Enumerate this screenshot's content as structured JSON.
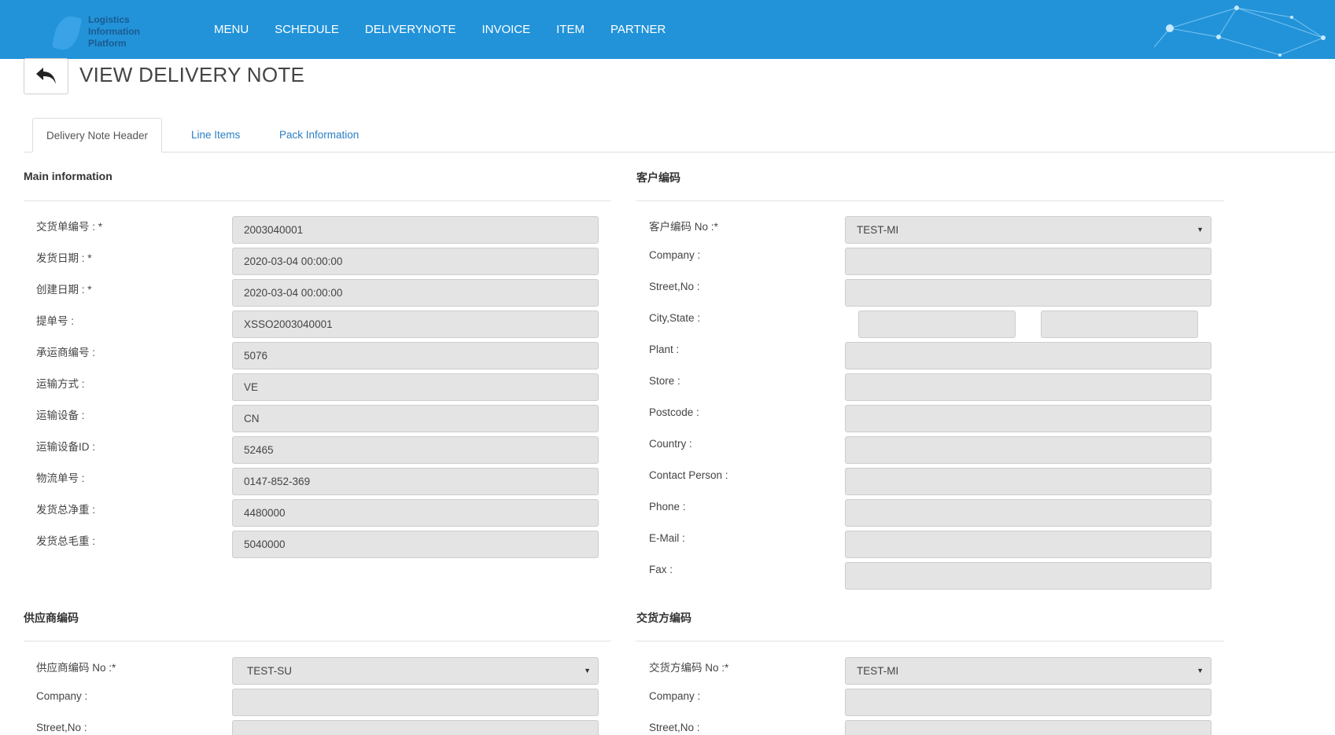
{
  "brand": {
    "logo_lines": [
      "Logistics",
      "Information",
      "Platform"
    ]
  },
  "nav": [
    "MENU",
    "SCHEDULE",
    "DELIVERYNOTE",
    "INVOICE",
    "ITEM",
    "PARTNER"
  ],
  "page": {
    "title": "VIEW DELIVERY NOTE"
  },
  "tabs": [
    "Delivery Note Header",
    "Line Items",
    "Pack Information"
  ],
  "main_info": {
    "title": "Main information",
    "fields": [
      {
        "label": "交货单编号 : *",
        "value": "2003040001"
      },
      {
        "label": "发货日期 : *",
        "value": "2020-03-04 00:00:00"
      },
      {
        "label": "创建日期 : *",
        "value": "2020-03-04 00:00:00"
      },
      {
        "label": "提单号 :",
        "value": "XSSO2003040001"
      },
      {
        "label": "承运商编号 :",
        "value": "5076"
      },
      {
        "label": "运输方式 :",
        "value": "VE"
      },
      {
        "label": "运输设备 :",
        "value": "CN"
      },
      {
        "label": "运输设备ID :",
        "value": "52465"
      },
      {
        "label": "物流单号 :",
        "value": "0147-852-369"
      },
      {
        "label": "发货总净重 :",
        "value": "4480000"
      },
      {
        "label": "发货总毛重 :",
        "value": "5040000"
      }
    ]
  },
  "customer": {
    "title": "客户编码",
    "select_label": "客户编码 No :*",
    "select_value": "TEST-MI",
    "fields": [
      {
        "label": "Company :",
        "value": ""
      },
      {
        "label": "Street,No :",
        "value": ""
      },
      {
        "label": "City,State :",
        "city": "",
        "state": ""
      },
      {
        "label": "Plant :",
        "value": ""
      },
      {
        "label": "Store :",
        "value": ""
      },
      {
        "label": "Postcode :",
        "value": ""
      },
      {
        "label": "Country :",
        "value": ""
      },
      {
        "label": "Contact Person :",
        "value": ""
      },
      {
        "label": "Phone :",
        "value": ""
      },
      {
        "label": "E-Mail :",
        "value": ""
      },
      {
        "label": "Fax :",
        "value": ""
      }
    ]
  },
  "supplier": {
    "title": "供应商编码",
    "select_label": "供应商编码 No :*",
    "select_value": "TEST-SU",
    "fields": [
      {
        "label": "Company :",
        "value": ""
      },
      {
        "label": "Street,No :",
        "value": ""
      }
    ]
  },
  "consignee": {
    "title": "交货方编码",
    "select_label": "交货方编码 No :*",
    "select_value": "TEST-MI",
    "fields": [
      {
        "label": "Company :",
        "value": ""
      },
      {
        "label": "Street,No :",
        "value": ""
      }
    ]
  },
  "colors": {
    "nav_bg": "#2293d9",
    "field_bg": "#e4e4e4",
    "tab_link": "#2a7fc4"
  }
}
